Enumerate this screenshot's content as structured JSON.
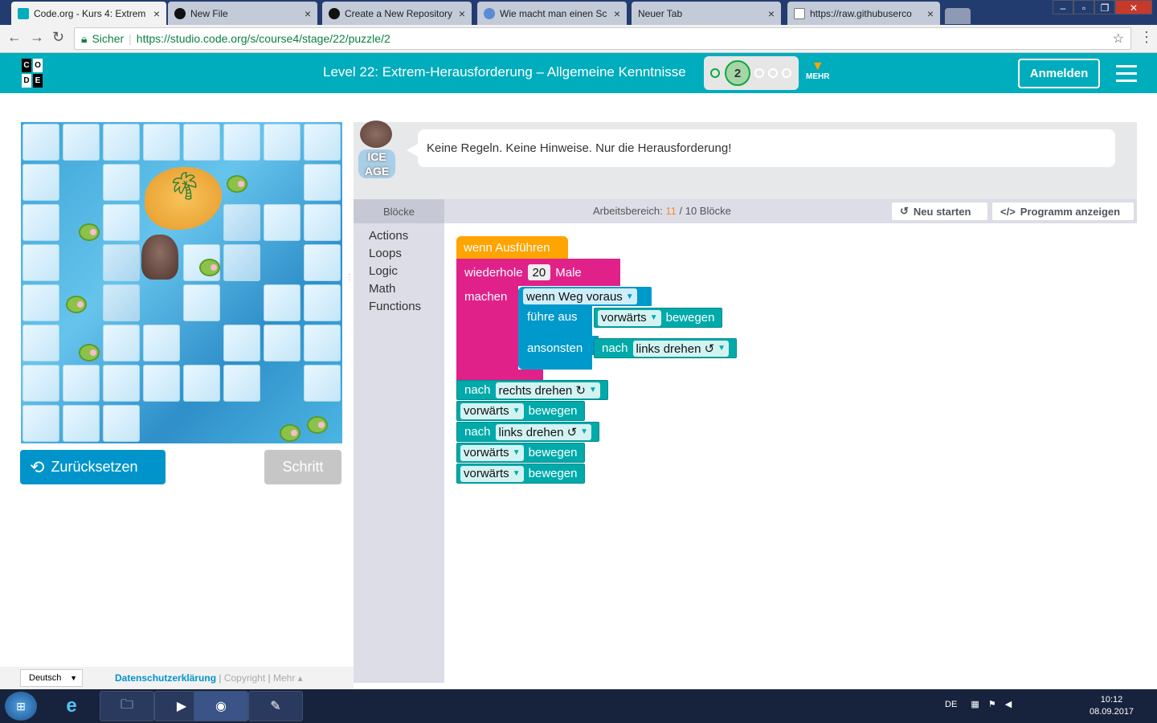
{
  "browser": {
    "tabs": [
      {
        "title": "Code.org - Kurs 4: Extrem"
      },
      {
        "title": "New File"
      },
      {
        "title": "Create a New Repository"
      },
      {
        "title": "Wie macht man einen Sc"
      },
      {
        "title": "Neuer Tab"
      },
      {
        "title": "https://raw.githubuserco"
      }
    ],
    "secure_label": "Sicher",
    "url": "https://studio.code.org/s/course4/stage/22/puzzle/2"
  },
  "header": {
    "logo_letters": [
      "C",
      "O",
      "D",
      "E"
    ],
    "level_title": "Level 22: Extrem-Herausforderung – Allgemeine Kenntnisse",
    "current_puzzle": "2",
    "more_label": "MEHR",
    "signin_label": "Anmelden"
  },
  "game": {
    "reset_label": "Zurücksetzen",
    "step_label": "Schritt"
  },
  "instructions": {
    "character_logo": "ICE AGE",
    "text": "Keine Regeln. Keine Hinweise. Nur die Herausforderung!"
  },
  "workspace": {
    "toolbox_header": "Blöcke",
    "count_label_prefix": "Arbeitsbereich:",
    "count_used": "11",
    "count_sep": "/",
    "count_limit": "10 Blöcke",
    "restart_label": "Neu starten",
    "show_code_label": "Programm anzeigen"
  },
  "toolbox": {
    "categories": [
      "Actions",
      "Loops",
      "Logic",
      "Math",
      "Functions"
    ]
  },
  "blocks": {
    "when_run": "wenn Ausführen",
    "repeat": "wiederhole",
    "repeat_count": "20",
    "repeat_suffix": "Male",
    "do": "machen",
    "if_path": "wenn Weg voraus",
    "then": "führe aus",
    "else": "ansonsten",
    "forward": "vorwärts",
    "move": "bewegen",
    "turn_prefix": "nach",
    "turn_left": "links drehen ↺",
    "turn_right": "rechts drehen ↻"
  },
  "footer": {
    "language": "Deutsch",
    "privacy": "Datenschutzerklärung",
    "copyright": "Copyright",
    "more": "Mehr ▴"
  },
  "taskbar": {
    "lang": "DE",
    "time": "10:12",
    "date": "08.09.2017"
  },
  "colors": {
    "brand": "#00adbc",
    "reset_button": "#0094ca",
    "event_block": "#ffa400",
    "loop_block": "#e0218a",
    "action_block": "#00aaaa",
    "logic_block": "#0099cc"
  }
}
